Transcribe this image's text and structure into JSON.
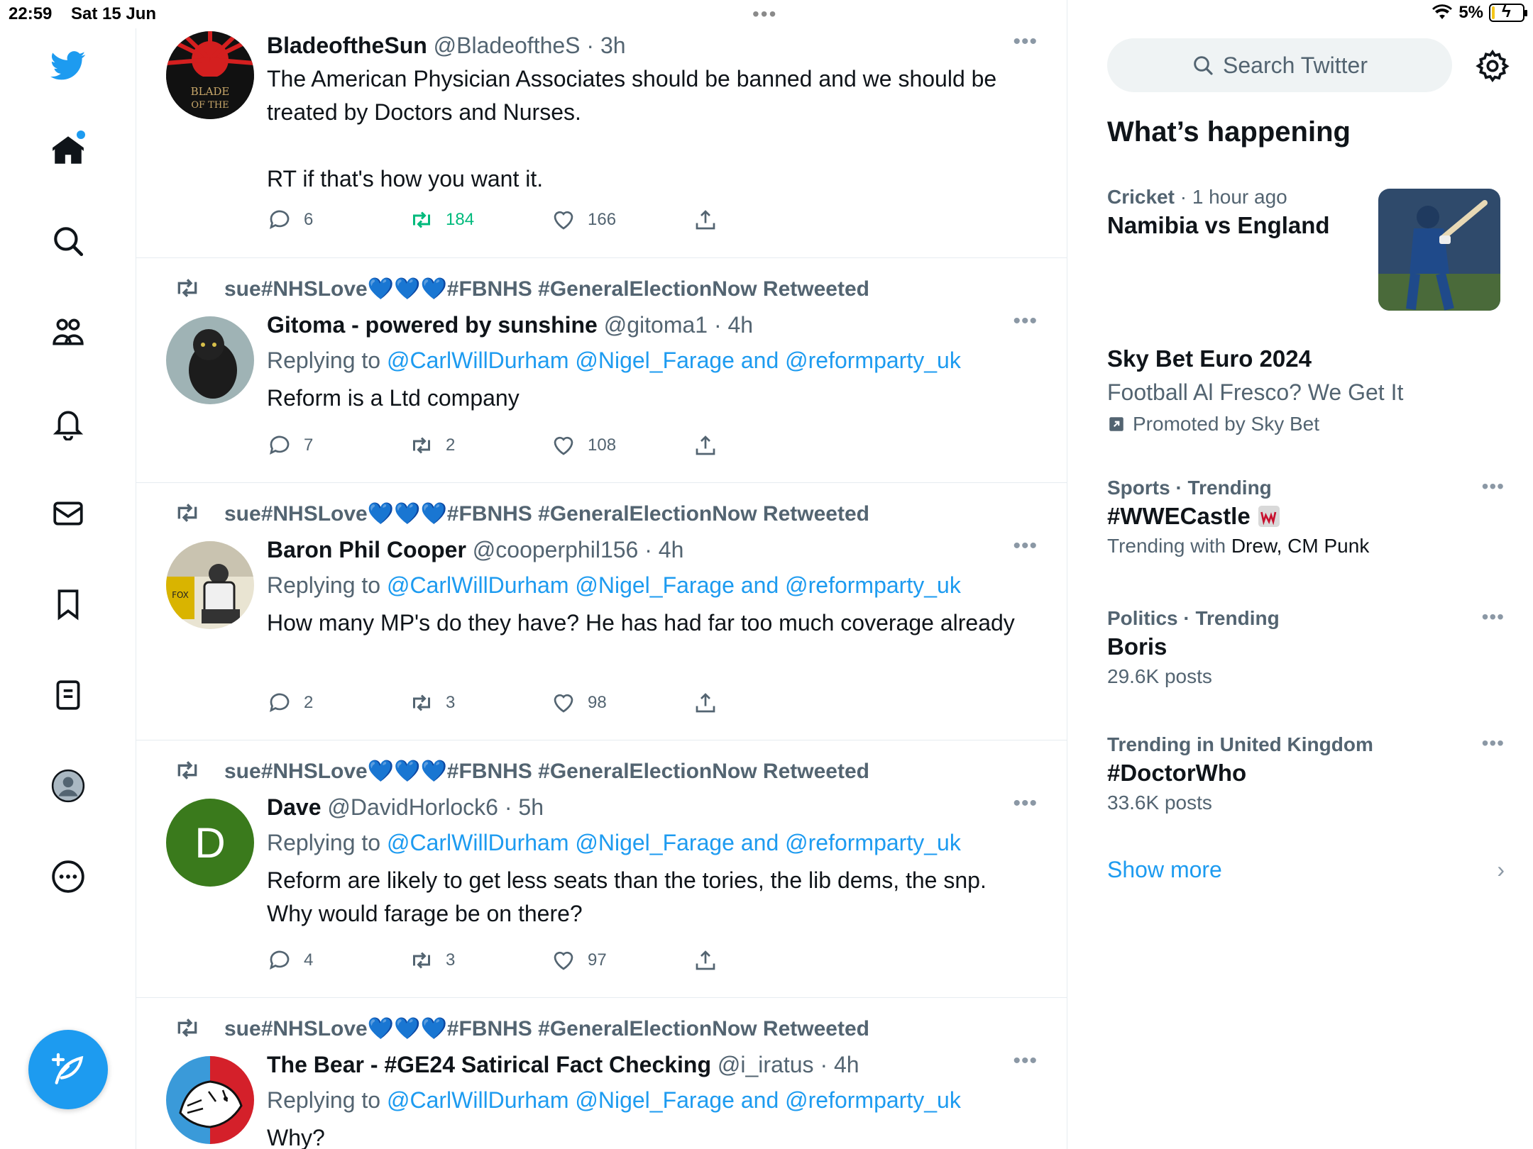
{
  "status_bar": {
    "time": "22:59",
    "date": "Sat 15 Jun",
    "battery": "5%"
  },
  "colors": {
    "accent": "#1d9bf0",
    "muted": "#536471",
    "retweet_green": "#00ba7c"
  },
  "nav": {
    "items": [
      "twitter-logo",
      "home-icon",
      "search-icon",
      "communities-icon",
      "notifications-icon",
      "messages-icon",
      "bookmarks-icon",
      "lists-icon",
      "profile-icon",
      "more-icon"
    ]
  },
  "timeline": {
    "tweets": [
      {
        "name": "BladeoftheSun",
        "handle": "@BladeoftheS",
        "time": "· 3h",
        "text": "The American Physician Associates should be banned and we should be treated by Doctors and Nurses.\n\nRT if that's how you want it.",
        "replies": "6",
        "retweets": "184",
        "likes": "166"
      },
      {
        "retweeted_by": "sue#NHSLove💙💙💙#FBNHS #GeneralElectionNow Retweeted",
        "name": "Gitoma - powered by sunshine",
        "handle": "@gitoma1",
        "time": "· 4h",
        "replying_label": "Replying to",
        "replying_to": "@CarlWillDurham @Nigel_Farage and @reformparty_uk",
        "text": "Reform is a Ltd company",
        "replies": "7",
        "retweets": "2",
        "likes": "108"
      },
      {
        "retweeted_by": "sue#NHSLove💙💙💙#FBNHS #GeneralElectionNow Retweeted",
        "name": "Baron Phil Cooper",
        "handle": "@cooperphil156",
        "time": "· 4h",
        "replying_label": "Replying to",
        "replying_to": "@CarlWillDurham @Nigel_Farage and @reformparty_uk",
        "text": "How many MP's do they have? He has had far too much coverage already",
        "replies": "2",
        "retweets": "3",
        "likes": "98"
      },
      {
        "retweeted_by": "sue#NHSLove💙💙💙#FBNHS #GeneralElectionNow Retweeted",
        "name": "Dave",
        "handle": "@DavidHorlock6",
        "time": "· 5h",
        "avatar_letter": "D",
        "replying_label": "Replying to",
        "replying_to": "@CarlWillDurham @Nigel_Farage and @reformparty_uk",
        "text": "Reform are likely to get less seats than the tories, the lib dems, the snp. Why would farage be on there?",
        "replies": "4",
        "retweets": "3",
        "likes": "97"
      },
      {
        "retweeted_by": "sue#NHSLove💙💙💙#FBNHS #GeneralElectionNow Retweeted",
        "name": "The Bear - #GE24 Satirical Fact Checking",
        "handle": "@i_iratus",
        "time": "· 4h",
        "replying_label": "Replying to",
        "replying_to": "@CarlWillDurham @Nigel_Farage and @reformparty_uk",
        "text": "Why?"
      }
    ]
  },
  "sidebar": {
    "search_placeholder": "Search Twitter",
    "heading": "What’s happening",
    "trends": [
      {
        "meta_a": "Cricket",
        "meta_b": " · 1 hour ago",
        "title": "Namibia vs England"
      },
      {
        "title": "Sky Bet Euro 2024",
        "sub": "Football Al Fresco? We Get It",
        "promo": "Promoted by Sky Bet"
      },
      {
        "meta_a": "Sports · Trending",
        "title": "#WWECastle",
        "sub_a": "Trending with ",
        "sub_b": "Drew, CM Punk"
      },
      {
        "meta_a": "Politics · Trending",
        "title": "Boris",
        "sub": "29.6K posts"
      },
      {
        "meta_a": "Trending in United Kingdom",
        "title": "#DoctorWho",
        "sub": "33.6K posts"
      }
    ],
    "show_more": "Show more"
  }
}
